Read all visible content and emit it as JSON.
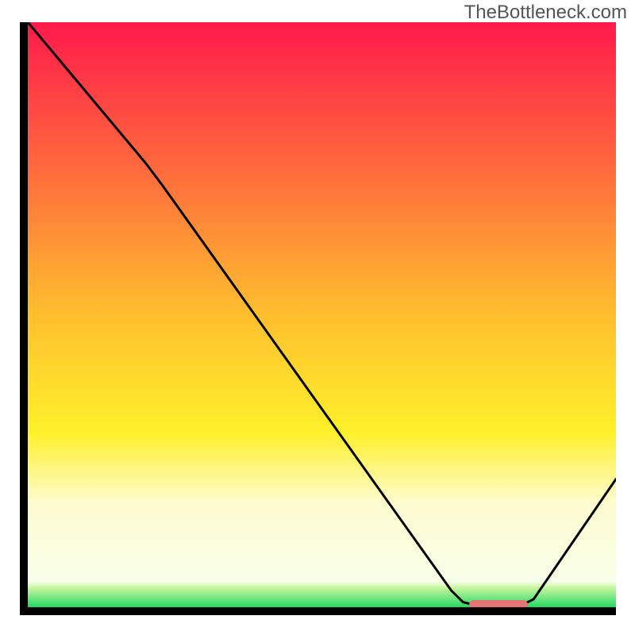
{
  "attribution": "TheBottleneck.com",
  "chart_data": {
    "type": "line",
    "title": "",
    "xlabel": "",
    "ylabel": "",
    "xlim": [
      0,
      100
    ],
    "ylim": [
      0,
      100
    ],
    "gradient_stops": [
      {
        "offset": 0,
        "color": "#ff1a4b"
      },
      {
        "offset": 0.25,
        "color": "#ff6a3d"
      },
      {
        "offset": 0.5,
        "color": "#ffbf2e"
      },
      {
        "offset": 0.7,
        "color": "#fff02a"
      },
      {
        "offset": 0.82,
        "color": "#fdfccf"
      },
      {
        "offset": 0.955,
        "color": "#f8ffe8"
      },
      {
        "offset": 0.965,
        "color": "#c8f7a0"
      },
      {
        "offset": 1.0,
        "color": "#1fd65f"
      }
    ],
    "curve_points": [
      {
        "x": 0,
        "y": 100
      },
      {
        "x": 20,
        "y": 76
      },
      {
        "x": 23,
        "y": 72
      },
      {
        "x": 72,
        "y": 3
      },
      {
        "x": 74,
        "y": 1
      },
      {
        "x": 76,
        "y": 0.5
      },
      {
        "x": 84,
        "y": 0.5
      },
      {
        "x": 86,
        "y": 1.5
      },
      {
        "x": 100,
        "y": 22
      }
    ],
    "minimum_band": {
      "x_start": 75,
      "x_end": 85,
      "y": 0.5
    }
  }
}
